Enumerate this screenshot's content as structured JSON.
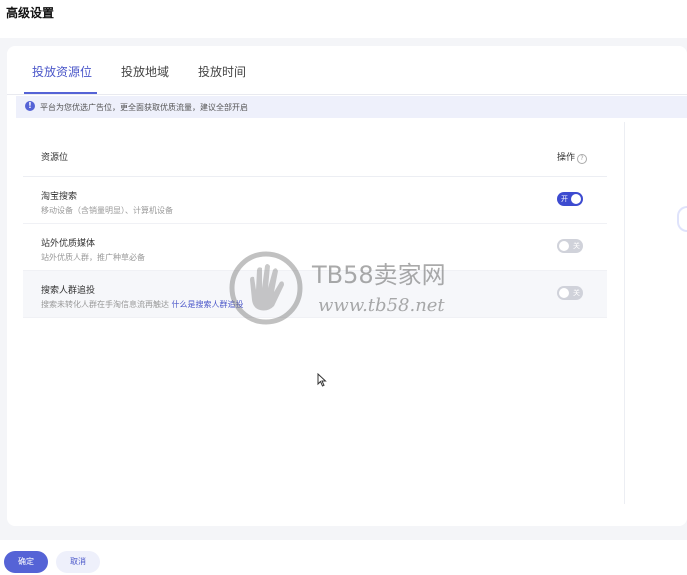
{
  "page": {
    "title": "高级设置"
  },
  "tabs": [
    {
      "label": "投放资源位",
      "active": true
    },
    {
      "label": "投放地域",
      "active": false
    },
    {
      "label": "投放时间",
      "active": false
    }
  ],
  "notice": {
    "icon": "info-icon",
    "glyph": "!",
    "text": "平台为您优选广告位，更全面获取优质流量，建议全部开启"
  },
  "table": {
    "headers": {
      "resource": "资源位",
      "operation": "操作",
      "help_glyph": "?"
    },
    "rows": [
      {
        "name": "淘宝搜索",
        "desc": "移动设备（含销量明显）、计算机设备",
        "link": "",
        "toggle_label": "开",
        "enabled": true
      },
      {
        "name": "站外优质媒体",
        "desc": "站外优质人群，推广种草必备",
        "link": "",
        "toggle_label": "关",
        "enabled": false
      },
      {
        "name": "搜索人群追投",
        "desc": "搜索未转化人群在手淘信息流再触达",
        "link": "什么是搜索人群追投",
        "toggle_label": "关",
        "enabled": false
      }
    ]
  },
  "watermark": {
    "title": "TB58卖家网",
    "url": "www.tb58.net"
  },
  "footer": {
    "confirm_label": "确定",
    "cancel_label": "取消"
  },
  "colors": {
    "accent": "#5563d6",
    "toggle_on": "#3d4bd0",
    "toggle_off": "#d0d2da",
    "notice_bg": "#eef0fb"
  }
}
